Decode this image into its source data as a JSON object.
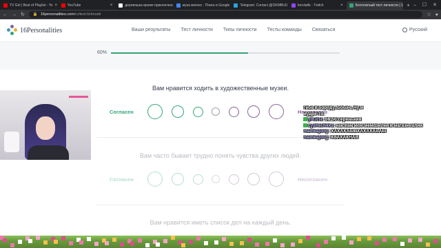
{
  "browser": {
    "tabs": [
      {
        "title": "TV Girl | Best of Playlist - Yo",
        "fav": "#ff0000",
        "active": false
      },
      {
        "title": "YouTube",
        "fav": "#ff0000",
        "active": false
      },
      {
        "title": "деревяшка время приключений",
        "fav": "#ffffff",
        "active": false
      },
      {
        "title": "муза винчес - Поиск в Google",
        "fav": "#4285f4",
        "active": false
      },
      {
        "title": "Telegram: Contact @OKMBUU",
        "fav": "#2aa3de",
        "active": false
      },
      {
        "title": "kerolaife - Twitch",
        "fav": "#9146ff",
        "active": false
      },
      {
        "title": "Бесплатный тест личности | 16",
        "fav": "#33a474",
        "active": true
      }
    ],
    "url_host": "16personalities.com",
    "url_path": "/ru/test-lichnosti"
  },
  "site": {
    "logo_text": "16Personalities",
    "nav": [
      "Ваши результаты",
      "Тест личности",
      "Типы личности",
      "Тесты команды",
      "Связаться"
    ],
    "language": "Русский"
  },
  "progress": {
    "label": "60%",
    "value": 0.6
  },
  "questions": [
    {
      "text": "Вам нравится ходить в художественные музеи.",
      "agree": "Согласен",
      "disagree": "Несогласен",
      "faded": false
    },
    {
      "text": "Вам часто бывает трудно понять чувства других людей.",
      "agree": "Согласен",
      "disagree": "Несогласен",
      "faded": true
    },
    {
      "text": "Вам нравится иметь список дел на каждый день.",
      "agree": "",
      "disagree": "",
      "faded": true
    }
  ],
  "scale_colors": {
    "agree": "#33a474",
    "neutral": "#9b9faa",
    "disagree": "#88619a"
  },
  "chat": [
    {
      "user": "",
      "message": "Тебе в бороду, Бобэн, Ну и"
    },
    {
      "user": "",
      "message": "мудря-то."
    },
    {
      "user": "ymJria",
      "message": "08:50 серенький"
    },
    {
      "user": "cyshechkka",
      "message": "как вам мои мемозилки в магазиналии"
    },
    {
      "user": "mamkajong",
      "message": "ХАХАХАЫВХАХАХАЬАЫ"
    },
    {
      "user": "mamkajong",
      "message": "КВАХАКНАЯ"
    }
  ]
}
